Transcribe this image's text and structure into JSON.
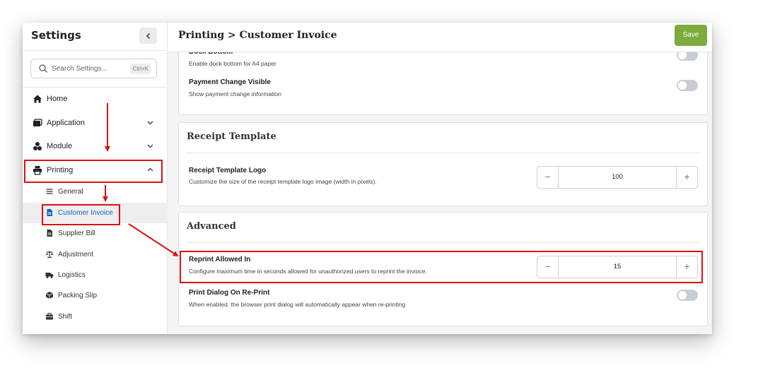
{
  "sidebar": {
    "title": "Settings",
    "search": {
      "placeholder": "Search Settings...",
      "shortcut": "Ctrl+K"
    },
    "nav": [
      {
        "label": "Home",
        "icon": "home-icon"
      },
      {
        "label": "Application",
        "icon": "application-icon",
        "expandable": true
      },
      {
        "label": "Module",
        "icon": "module-icon",
        "expandable": true
      },
      {
        "label": "Printing",
        "icon": "printer-icon",
        "expanded": true
      }
    ],
    "printing_items": [
      {
        "label": "General",
        "icon": "menu-lines-icon"
      },
      {
        "label": "Customer Invoice",
        "icon": "document-icon",
        "active": true
      },
      {
        "label": "Supplier Bill",
        "icon": "bill-icon"
      },
      {
        "label": "Adjustment",
        "icon": "scale-icon"
      },
      {
        "label": "Logistics",
        "icon": "truck-icon"
      },
      {
        "label": "Packing Slip",
        "icon": "box-icon"
      },
      {
        "label": "Shift",
        "icon": "briefcase-icon"
      }
    ]
  },
  "header": {
    "title": "Printing > Customer Invoice",
    "save_label": "Save"
  },
  "sections": {
    "layout": {
      "rows": [
        {
          "title": "Dock Bottom",
          "description": "Enable dock bottom for A4 paper",
          "enabled": false
        },
        {
          "title": "Payment Change Visible",
          "description": "Show payment change information",
          "enabled": false
        }
      ]
    },
    "receipt_template": {
      "title": "Receipt Template",
      "logo": {
        "title": "Receipt Template Logo",
        "description": "Customize the size of the receipt template logo image (width in pixels).",
        "value": "100"
      }
    },
    "advanced": {
      "title": "Advanced",
      "reprint": {
        "title": "Reprint Allowed In",
        "description": "Configure maximum time in seconds allowed for unauthorized users to reprint the invoice.",
        "value": "15"
      },
      "print_dialog": {
        "title": "Print Dialog On Re-Print",
        "description": "When enabled, the browser print dialog will automatically appear when re-printing",
        "enabled": false
      }
    }
  },
  "colors": {
    "accent_save": "#7cab3e",
    "active_link": "#1565c0",
    "annotation": "#e01010"
  }
}
